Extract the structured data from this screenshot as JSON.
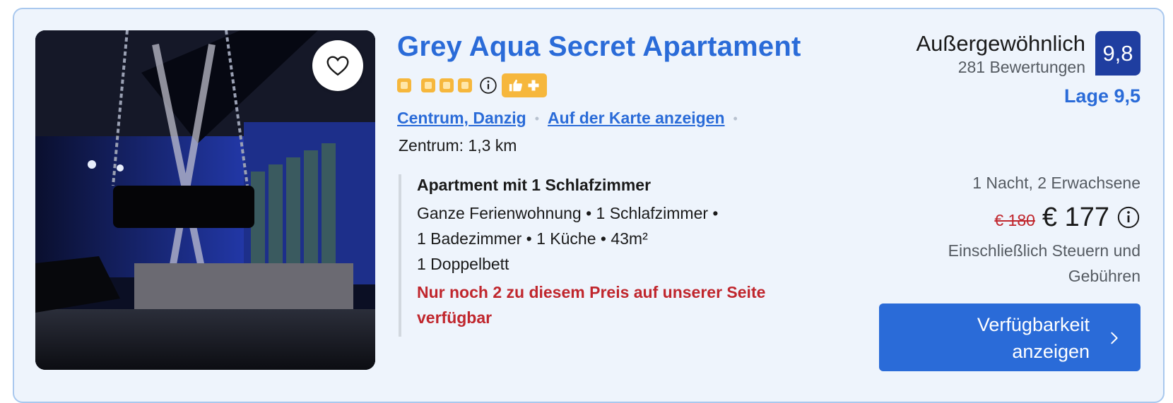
{
  "property": {
    "name": "Grey Aqua Secret Apartament",
    "star_count": 4,
    "location_link": "Centrum, Danzig",
    "map_link": "Auf der Karte anzeigen",
    "distance": "Zentrum: 1,3 km"
  },
  "room": {
    "title": "Apartment mit 1 Schlafzimmer",
    "details_line1": "Ganze Ferienwohnung • 1 Schlafzimmer •",
    "details_line2": "1 Badezimmer • 1 Küche • 43m²",
    "details_line3": "1 Doppelbett",
    "urgency_line1": "Nur noch 2 zu diesem Preis auf unserer Seite",
    "urgency_line2": "verfügbar"
  },
  "rating": {
    "word": "Außergewöhnlich",
    "reviews": "281 Bewertungen",
    "score": "9,8",
    "location_score": "Lage 9,5"
  },
  "pricing": {
    "stay": "1 Nacht, 2 Erwachsene",
    "old_price": "€ 180",
    "new_price": "€ 177",
    "taxes_line1": "Einschließlich Steuern und",
    "taxes_line2": "Gebühren"
  },
  "cta": {
    "line1": "Verfügbarkeit",
    "line2": "anzeigen"
  },
  "icons": {
    "favorite": "heart-icon",
    "info": "info-icon",
    "preferred": "thumbs-up-plus-icon",
    "cta": "chevron-right-icon"
  },
  "colors": {
    "brand_blue": "#2a6bd8",
    "score_bg": "#1f3ea0",
    "star": "#f6b73c",
    "urgent_red": "#c0262d",
    "card_bg": "#eef4fc"
  }
}
